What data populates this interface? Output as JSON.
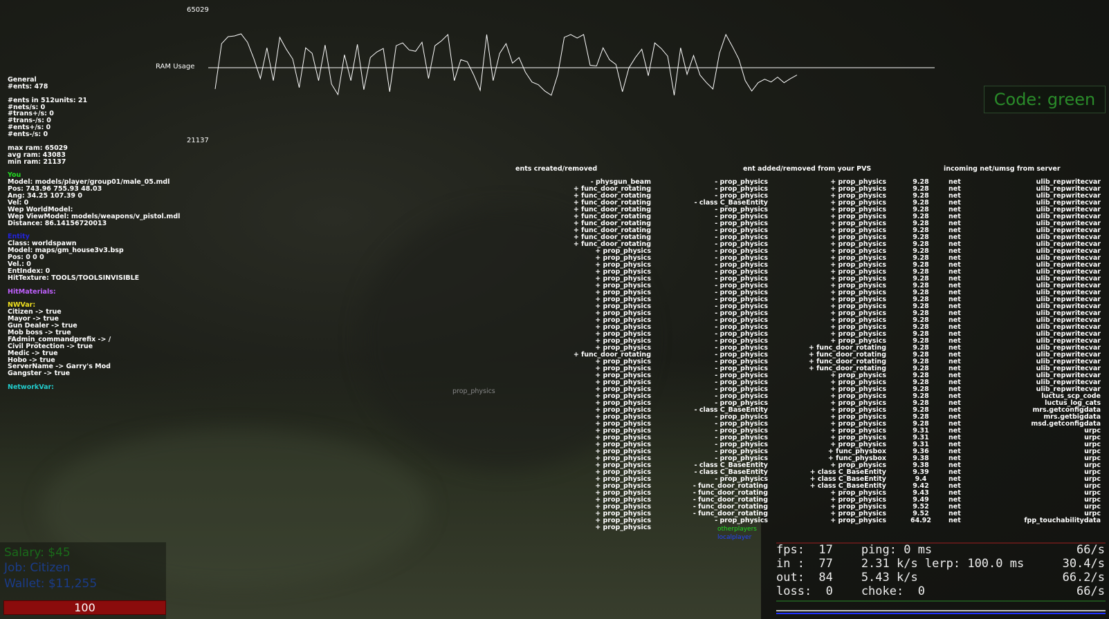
{
  "ram": {
    "label": "RAM Usage",
    "max_label": "65029",
    "min_label": "21137",
    "samples": [
      20,
      85,
      95,
      96,
      99,
      87,
      63,
      35,
      79,
      32,
      94,
      77,
      63,
      22,
      79,
      71,
      32,
      83,
      27,
      12,
      69,
      32,
      84,
      19,
      65,
      73,
      78,
      16,
      82,
      86,
      76,
      74,
      87,
      35,
      82,
      89,
      98,
      32,
      62,
      59,
      40,
      18,
      98,
      32,
      71,
      85,
      57,
      65,
      44,
      30,
      26,
      17,
      11,
      41,
      94,
      98,
      93,
      98,
      54,
      53,
      79,
      62,
      55,
      16,
      50,
      65,
      77,
      39,
      86,
      78,
      67,
      11,
      79,
      41,
      68,
      40,
      29,
      20,
      71,
      98,
      81,
      63,
      32,
      17,
      29,
      34,
      30,
      37,
      29,
      35,
      40
    ]
  },
  "code_status": "Code: green",
  "general": {
    "lines": [
      "General",
      "#ents: 478",
      "",
      "#ents in 512units: 21",
      "#nets/s: 0",
      "#trans+/s: 0",
      "#trans-/s: 0",
      "#ents+/s: 0",
      "#ents-/s: 0",
      "",
      "max ram: 65029",
      "avg ram: 43083",
      "min ram: 21137",
      "",
      "You",
      "Model: models/player/group01/male_05.mdl",
      "Pos: 743.96 755.93 48.03",
      "Ang: 34.25 107.39 0",
      "Vel: 0",
      "Wep WorldModel:",
      "Wep ViewModel: models/weapons/v_pistol.mdl",
      "Distance: 86.14156720013",
      "",
      "Entity",
      "Class: worldspawn",
      "Model: maps/gm_house3v3.bsp",
      "Pos: 0 0 0",
      "Vel.: 0",
      "EntIndex: 0",
      "HitTexture: TOOLS/TOOLSINVISIBLE",
      "",
      "HitMaterials:",
      "",
      "NWVar:",
      "Citizen -> true",
      "Mayor -> true",
      "Gun Dealer -> true",
      "Mob boss -> true",
      "FAdmin_commandprefix -> /",
      "Civil Protection -> true",
      "Medic -> true",
      "Hobo -> true",
      "ServerName -> Garry's Mod",
      "Gangster -> true",
      "",
      "NetworkVar:"
    ],
    "colors": {
      "you": "#22dd22",
      "entity": "#2222dd",
      "hitmaterials": "#c060ff",
      "nwvar": "#f0e020",
      "networkvar": "#22cccc"
    }
  },
  "headers": {
    "created": "ents created/removed",
    "pvs": "ent added/removed from your PVS",
    "incoming": "incoming net/umsg from server"
  },
  "floating_label": "prop_physics",
  "created": [
    "- physgun_beam",
    "+ func_door_rotating",
    "+ func_door_rotating",
    "+ func_door_rotating",
    "+ func_door_rotating",
    "+ func_door_rotating",
    "+ func_door_rotating",
    "+ func_door_rotating",
    "+ func_door_rotating",
    "+ func_door_rotating",
    "+ prop_physics",
    "+ prop_physics",
    "+ prop_physics",
    "+ prop_physics",
    "+ prop_physics",
    "+ prop_physics",
    "+ prop_physics",
    "+ prop_physics",
    "+ prop_physics",
    "+ prop_physics",
    "+ prop_physics",
    "+ prop_physics",
    "+ prop_physics",
    "+ prop_physics",
    "+ prop_physics",
    "+ func_door_rotating",
    "+ prop_physics",
    "+ prop_physics",
    "+ prop_physics",
    "+ prop_physics",
    "+ prop_physics",
    "+ prop_physics",
    "+ prop_physics",
    "+ prop_physics",
    "+ prop_physics",
    "+ prop_physics",
    "+ prop_physics",
    "+ prop_physics",
    "+ prop_physics",
    "+ prop_physics",
    "+ prop_physics",
    "+ prop_physics",
    "+ prop_physics",
    "+ prop_physics",
    "+ prop_physics",
    "+ prop_physics",
    "+ prop_physics",
    "+ prop_physics",
    "+ prop_physics",
    "+ prop_physics",
    "+ prop_physics"
  ],
  "removed": [
    "- prop_physics",
    "- prop_physics",
    "- prop_physics",
    "- class C_BaseEntity",
    "- prop_physics",
    "- prop_physics",
    "- prop_physics",
    "- prop_physics",
    "- prop_physics",
    "- prop_physics",
    "- prop_physics",
    "- prop_physics",
    "- prop_physics",
    "- prop_physics",
    "- prop_physics",
    "- prop_physics",
    "- prop_physics",
    "- prop_physics",
    "- prop_physics",
    "- prop_physics",
    "- prop_physics",
    "- prop_physics",
    "- prop_physics",
    "- prop_physics",
    "- prop_physics",
    "- prop_physics",
    "- prop_physics",
    "- prop_physics",
    "- prop_physics",
    "- prop_physics",
    "- prop_physics",
    "- prop_physics",
    "- prop_physics",
    "- class C_BaseEntity",
    "- prop_physics",
    "- prop_physics",
    "- prop_physics",
    "- prop_physics",
    "- prop_physics",
    "- prop_physics",
    "- prop_physics",
    "- class C_BaseEntity",
    "- class C_BaseEntity",
    "- prop_physics",
    "- func_door_rotating",
    "- func_door_rotating",
    "- func_door_rotating",
    "- func_door_rotating",
    "- func_door_rotating",
    "- prop_physics"
  ],
  "pvs": [
    "+ prop_physics",
    "+ prop_physics",
    "+ prop_physics",
    "+ prop_physics",
    "+ prop_physics",
    "+ prop_physics",
    "+ prop_physics",
    "+ prop_physics",
    "+ prop_physics",
    "+ prop_physics",
    "+ prop_physics",
    "+ prop_physics",
    "+ prop_physics",
    "+ prop_physics",
    "+ prop_physics",
    "+ prop_physics",
    "+ prop_physics",
    "+ prop_physics",
    "+ prop_physics",
    "+ prop_physics",
    "+ prop_physics",
    "+ prop_physics",
    "+ prop_physics",
    "+ prop_physics",
    "+ func_door_rotating",
    "+ func_door_rotating",
    "+ func_door_rotating",
    "+ func_door_rotating",
    "+ prop_physics",
    "+ prop_physics",
    "+ prop_physics",
    "+ prop_physics",
    "+ prop_physics",
    "+ prop_physics",
    "+ prop_physics",
    "+ prop_physics",
    "+ prop_physics",
    "+ prop_physics",
    "+ prop_physics",
    "+ func_physbox",
    "+ func_physbox",
    "+ prop_physics",
    "+ class C_BaseEntity",
    "+ class C_BaseEntity",
    "+ class C_BaseEntity",
    "+ prop_physics",
    "+ prop_physics",
    "+ prop_physics",
    "+ prop_physics",
    "+ prop_physics"
  ],
  "times": [
    "9.28",
    "9.28",
    "9.28",
    "9.28",
    "9.28",
    "9.28",
    "9.28",
    "9.28",
    "9.28",
    "9.28",
    "9.28",
    "9.28",
    "9.28",
    "9.28",
    "9.28",
    "9.28",
    "9.28",
    "9.28",
    "9.28",
    "9.28",
    "9.28",
    "9.28",
    "9.28",
    "9.28",
    "9.28",
    "9.28",
    "9.28",
    "9.28",
    "9.28",
    "9.28",
    "9.28",
    "9.28",
    "9.28",
    "9.28",
    "9.28",
    "9.28",
    "9.31",
    "9.31",
    "9.31",
    "9.36",
    "9.38",
    "9.38",
    "9.39",
    "9.4",
    "9.42",
    "9.43",
    "9.49",
    "9.52",
    "9.52",
    "64.92"
  ],
  "types": [
    "net",
    "net",
    "net",
    "net",
    "net",
    "net",
    "net",
    "net",
    "net",
    "net",
    "net",
    "net",
    "net",
    "net",
    "net",
    "net",
    "net",
    "net",
    "net",
    "net",
    "net",
    "net",
    "net",
    "net",
    "net",
    "net",
    "net",
    "net",
    "net",
    "net",
    "net",
    "net",
    "net",
    "net",
    "net",
    "net",
    "net",
    "net",
    "net",
    "net",
    "net",
    "net",
    "net",
    "net",
    "net",
    "net",
    "net",
    "net",
    "net",
    "net"
  ],
  "messages": [
    "ulib_repwritecvar",
    "ulib_repwritecvar",
    "ulib_repwritecvar",
    "ulib_repwritecvar",
    "ulib_repwritecvar",
    "ulib_repwritecvar",
    "ulib_repwritecvar",
    "ulib_repwritecvar",
    "ulib_repwritecvar",
    "ulib_repwritecvar",
    "ulib_repwritecvar",
    "ulib_repwritecvar",
    "ulib_repwritecvar",
    "ulib_repwritecvar",
    "ulib_repwritecvar",
    "ulib_repwritecvar",
    "ulib_repwritecvar",
    "ulib_repwritecvar",
    "ulib_repwritecvar",
    "ulib_repwritecvar",
    "ulib_repwritecvar",
    "ulib_repwritecvar",
    "ulib_repwritecvar",
    "ulib_repwritecvar",
    "ulib_repwritecvar",
    "ulib_repwritecvar",
    "ulib_repwritecvar",
    "ulib_repwritecvar",
    "ulib_repwritecvar",
    "ulib_repwritecvar",
    "ulib_repwritecvar",
    "luctus_scp_code",
    "luctus_log_cats",
    "mrs.getconfigdata",
    "mrs.getbigdata",
    "msd.getconfigdata",
    "urpc",
    "urpc",
    "urpc",
    "urpc",
    "urpc",
    "urpc",
    "urpc",
    "urpc",
    "urpc",
    "urpc",
    "urpc",
    "urpc",
    "urpc",
    "fpp_touchabilitydata"
  ],
  "legend": {
    "items": [
      {
        "label": "otherplayers",
        "color": "#22dd22"
      },
      {
        "label": "localplayer",
        "color": "#2244ff"
      }
    ]
  },
  "hud": {
    "salary": "Salary: $45",
    "job": "Job: Citizen",
    "wallet": "Wallet: $11,255",
    "health": "100",
    "text_color": "#1a6a1a"
  },
  "netgraph": {
    "line1": "fps:  17    ping: 0 ms",
    "line2": "in :  77    2.31 k/s lerp: 100.0 ms",
    "line3": "out:  84    5.43 k/s",
    "line4": "loss:  0    choke:  0",
    "r1": "66/s",
    "r2": "30.4/s",
    "r3": "66.2/s",
    "r4": "66/s"
  }
}
